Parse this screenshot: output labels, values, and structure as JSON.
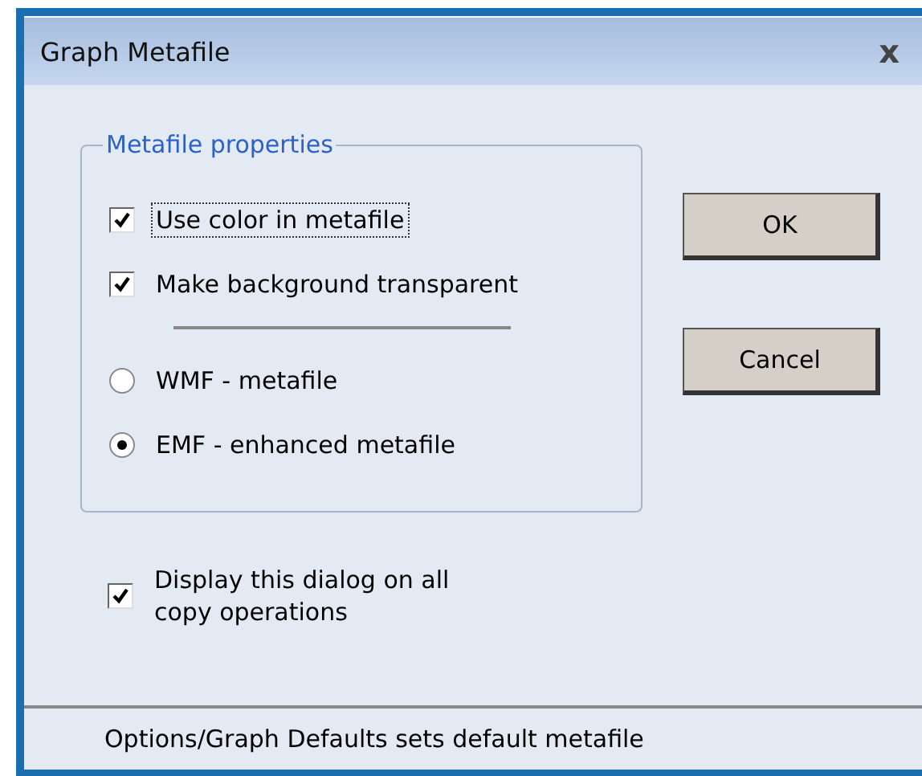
{
  "window": {
    "title": "Graph Metafile",
    "close": "x"
  },
  "group": {
    "legend": "Metafile properties",
    "options": [
      {
        "kind": "checkbox",
        "label": "Use color in metafile",
        "checked": true,
        "focused": true
      },
      {
        "kind": "checkbox",
        "label": "Make background transparent",
        "checked": true,
        "focused": false
      },
      {
        "kind": "divider"
      },
      {
        "kind": "radio",
        "label": "WMF - metafile",
        "selected": false,
        "focused": false
      },
      {
        "kind": "radio",
        "label": "EMF - enhanced metafile",
        "selected": true,
        "focused": false
      }
    ]
  },
  "buttons": [
    "OK",
    "Cancel"
  ],
  "display_dialog": {
    "label": "Display this dialog on all copy operations",
    "checked": true
  },
  "status_bar": "Options/Graph Defaults sets default metafile"
}
